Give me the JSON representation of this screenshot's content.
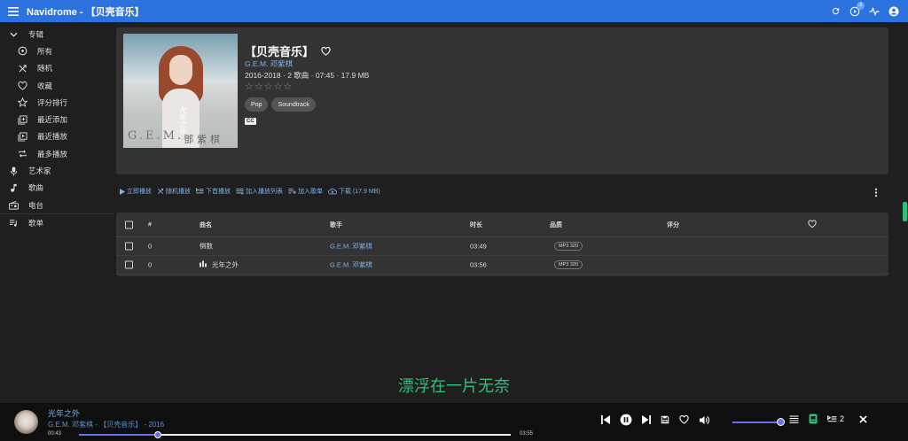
{
  "app": {
    "title": "Navidrome - 【贝壳音乐】",
    "badge_count": "3"
  },
  "sidebar": {
    "albums_label": "专辑",
    "album_items": [
      {
        "label": "所有",
        "icon": "album-icon"
      },
      {
        "label": "随机",
        "icon": "shuffle-icon"
      },
      {
        "label": "收藏",
        "icon": "heart-icon"
      },
      {
        "label": "评分排行",
        "icon": "star-icon"
      },
      {
        "label": "最近添加",
        "icon": "library-add-icon"
      },
      {
        "label": "最近播放",
        "icon": "library-play-icon"
      },
      {
        "label": "最多播放",
        "icon": "repeat-icon"
      }
    ],
    "artists_label": "艺术家",
    "songs_label": "歌曲",
    "radio_label": "电台",
    "playlists_label": "歌单"
  },
  "album": {
    "title": "【贝壳音乐】",
    "artist": "G.E.M. 邓紫棋",
    "meta": "2016-2018 · 2 歌曲 · 07:45 · 17.9 MB",
    "rating": "☆☆☆☆☆",
    "genres": [
      "Pop",
      "Soundtrack"
    ],
    "cc_label": "CC",
    "cover_brand": "G.E.M.",
    "cover_name": "鄧紫棋",
    "cover_side": "光年之外"
  },
  "actions": {
    "play_now": "立即播放",
    "shuffle": "随机播放",
    "play_next": "下首播放",
    "add_to_queue": "加入播放列表",
    "add_to_playlist": "加入歌单",
    "download": "下载 (17.9 MB)"
  },
  "table": {
    "headers": {
      "num": "#",
      "title": "曲名",
      "artist": "歌手",
      "duration": "时长",
      "quality": "品质",
      "rating": "评分"
    },
    "rows": [
      {
        "num": "0",
        "title": "倒数",
        "artist": "G.E.M. 邓紫棋",
        "duration": "03:49",
        "quality": "MP3 320"
      },
      {
        "num": "0",
        "title": "光年之外",
        "artist": "G.E.M. 邓紫棋",
        "duration": "03:56",
        "quality": "MP3 320"
      }
    ]
  },
  "lyric": "漂浮在一片无奈",
  "player": {
    "title": "光年之外",
    "subtitle": "G.E.M. 邓紫棋 - 【贝壳音乐】 - 2016",
    "current_time": "00:43",
    "total_time": "03:55",
    "progress": 0.182,
    "volume": 1.0,
    "queue_count": "2"
  },
  "colors": {
    "accent": "#2c73e0",
    "link": "#7fb0e8",
    "lyric": "#2fbf7a",
    "player_slider": "#6b6ff0"
  }
}
